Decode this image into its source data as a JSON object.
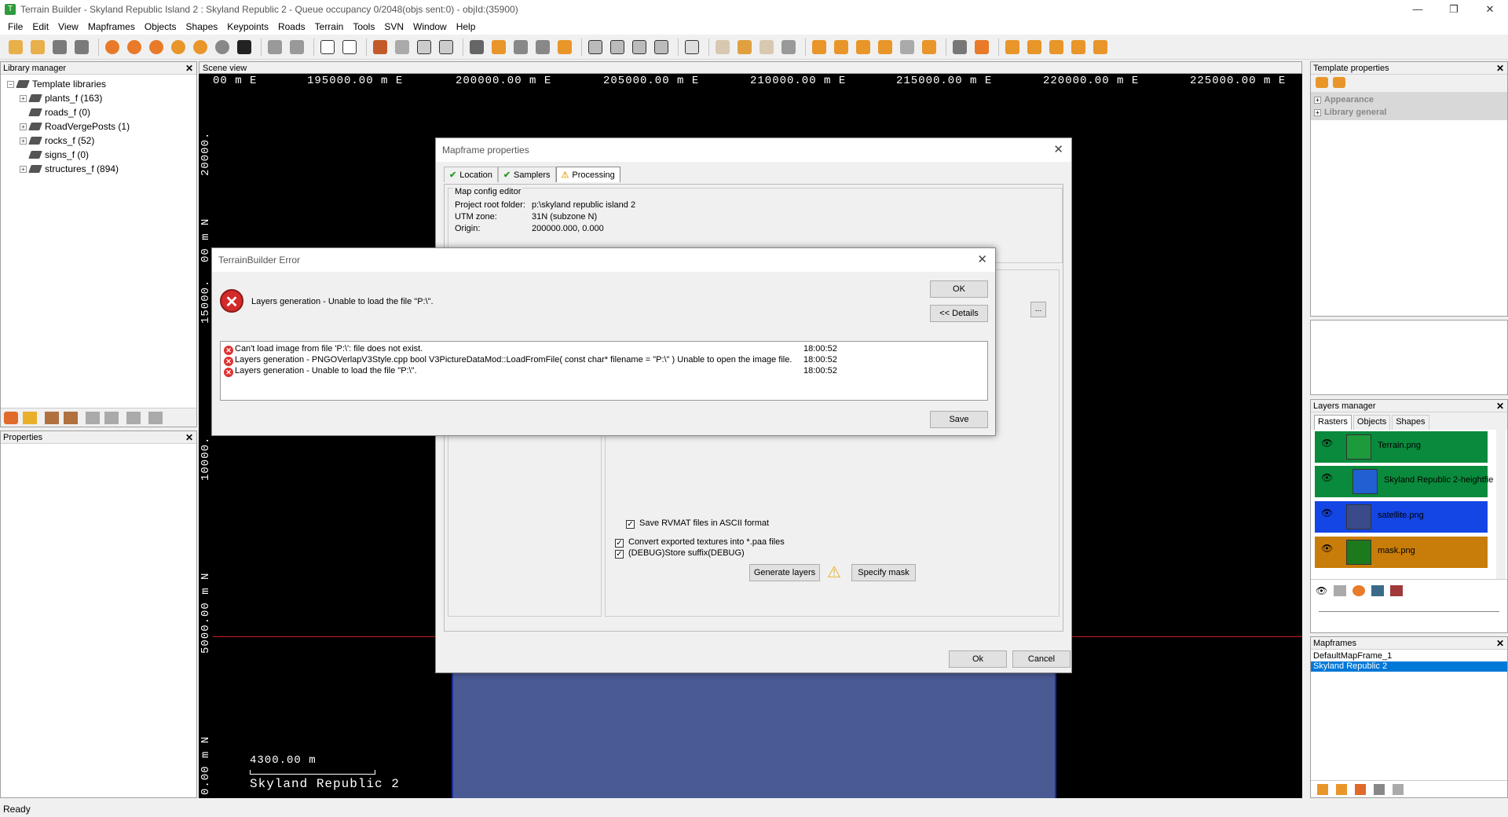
{
  "window": {
    "title": "Terrain Builder - Skyland Republic Island 2 : Skyland Republic 2 - Queue occupancy 0/2048(objs sent:0) - objId:(35900)",
    "minimize": "—",
    "maximize": "❐",
    "close": "✕"
  },
  "menu": [
    "File",
    "Edit",
    "View",
    "Mapframes",
    "Objects",
    "Shapes",
    "Keypoints",
    "Roads",
    "Terrain",
    "Tools",
    "SVN",
    "Window",
    "Help"
  ],
  "library_manager": {
    "title": "Library manager",
    "root": "Template libraries",
    "items": [
      {
        "label": "plants_f (163)",
        "expandable": true
      },
      {
        "label": "roads_f (0)",
        "expandable": false
      },
      {
        "label": "RoadVergePosts (1)",
        "expandable": true
      },
      {
        "label": "rocks_f (52)",
        "expandable": true
      },
      {
        "label": "signs_f (0)",
        "expandable": false
      },
      {
        "label": "structures_f (894)",
        "expandable": true
      }
    ]
  },
  "properties": {
    "title": "Properties"
  },
  "scene": {
    "title": "Scene view",
    "top_ticks": [
      "00 m E",
      "195000.00 m E",
      "200000.00 m E",
      "205000.00 m E",
      "210000.00 m E",
      "215000.00 m E",
      "220000.00 m E",
      "225000.00 m E"
    ],
    "left_ticks": [
      "20000.",
      "00 m N",
      "15000.",
      "10000.",
      "5000.00 m N",
      "0.00 m N"
    ],
    "scale_label": "4300.00 m",
    "map_name": "Skyland Republic 2"
  },
  "template_properties": {
    "title": "Template properties",
    "groups": [
      "Appearance",
      "Library general"
    ]
  },
  "layers_manager": {
    "title": "Layers manager",
    "tabs": [
      "Rasters",
      "Objects",
      "Shapes"
    ],
    "layers": [
      {
        "name": "Terrain.png",
        "color": "#0a8a3c"
      },
      {
        "name": "Skyland Republic 2-heightfield",
        "color": "#0a8a3c"
      },
      {
        "name": "satellite.png",
        "color": "#1446e6"
      },
      {
        "name": "mask.png",
        "color": "#c87d0a"
      }
    ]
  },
  "mapframes": {
    "title": "Mapframes",
    "items": [
      "DefaultMapFrame_1",
      "Skyland Republic 2"
    ],
    "selected_index": 1
  },
  "mapframe_dialog": {
    "title": "Mapframe properties",
    "tabs": [
      "Location",
      "Samplers",
      "Processing"
    ],
    "group_title": "Map config editor",
    "rows": [
      {
        "label": "Project root folder:",
        "value": "p:\\skyland republic island 2"
      },
      {
        "label": "UTM zone:",
        "value": "31N (subzone N)"
      },
      {
        "label": "Origin:",
        "value": "200000.000, 0.000"
      }
    ],
    "browse": "...",
    "save_rvmat": "Save RVMAT files in ASCII format",
    "convert_textures": "Convert exported textures into *.paa files",
    "debug_suffix": "(DEBUG)Store suffix(DEBUG)",
    "generate_layers": "Generate layers",
    "specify_mask": "Specify mask",
    "ok": "Ok",
    "cancel": "Cancel"
  },
  "error_dialog": {
    "title": "TerrainBuilder Error",
    "message": "Layers generation - Unable to load the file \"P:\\\".",
    "ok": "OK",
    "details": "<< Details",
    "save": "Save",
    "log": [
      {
        "text": "Can't load image from file 'P:\\': file does not exist.",
        "time": "18:00:52"
      },
      {
        "text": "Layers generation - PNGOVerlapV3Style.cpp    bool V3PictureDataMod::LoadFromFile( const char* filename = \"P:\\\" ) Unable to open the image file.",
        "time": "18:00:52"
      },
      {
        "text": "Layers generation - Unable to load the file \"P:\\\".",
        "time": "18:00:52"
      }
    ]
  },
  "status": "Ready"
}
